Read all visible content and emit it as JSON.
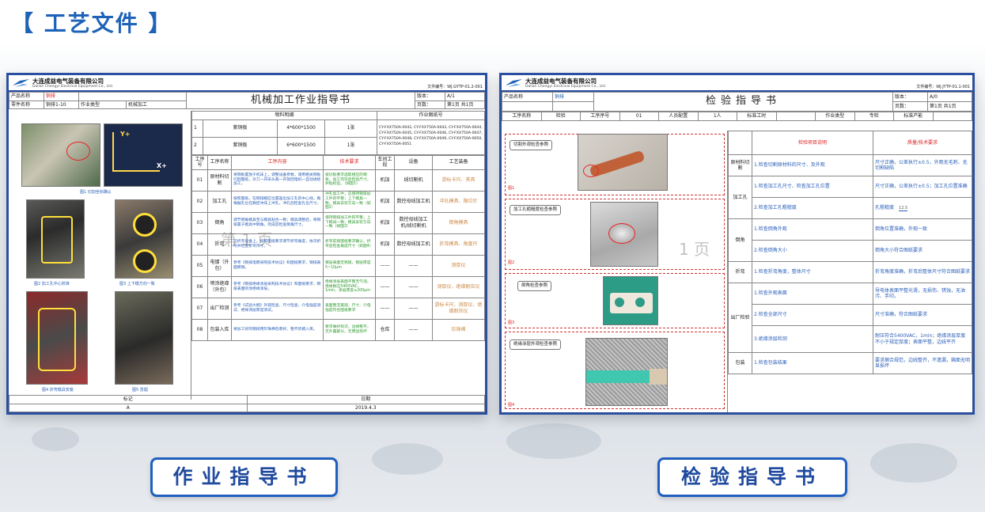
{
  "header": {
    "title": "【 工艺文件 】"
  },
  "buttons": {
    "work": "作业指导书",
    "inspect": "检验指导书"
  },
  "left_doc": {
    "company": "大连成益电气装备有限公司",
    "company_en": "Dalian Chengyi Electrical Equipment Co., Ltd.",
    "doc_code": "文件编号：WJ.GYTP-01.2-001",
    "product_label": "产品名称",
    "product_value": "铜排",
    "part_label": "零件名称",
    "part_value": "铜排1-10",
    "op_label": "作业类型",
    "op_value": "机械加工",
    "title": "机械加工作业指导书",
    "version_label": "版本：",
    "version_value": "A/1",
    "page_label": "页数：",
    "page_value": "第1页 共1页",
    "materials_header": "物料明细",
    "drawing_header": "作业图纸号",
    "materials": [
      {
        "no": "1",
        "name": "紫铜板",
        "spec": "4*600*1500",
        "qty": "1张",
        "drawing": "CY-FXX750A-0042, CY-FXX750A-0043, CY-FXX750A-0044, CY-FXX750A-0045, CY-FXX750A-0046, CY-FXX750A-0047, CY-FXX750A-0048, CY-FXX750A-0049, CY-FXX750A-0050, CY-FXX750A-0051"
      },
      {
        "no": "2",
        "name": "紫铜板",
        "spec": "6*600*1500",
        "qty": "1张",
        "drawing": ""
      }
    ],
    "step_headers": [
      "工序号",
      "工序名称",
      "工序内容",
      "技术要求",
      "车间工段",
      "设备",
      "工艺装备"
    ],
    "steps": [
      {
        "no": "01",
        "name": "原材料切割",
        "content": "将铜板置放于机床上，调整设备参数，调用相关铜板切割图纸，对刀一开床头裁一开放回电机一自动进给加工。",
        "req": "按切板要求选取相应的铜板，加工完毕后检验尺寸，并贴标签。（如图1）",
        "dept": "机加",
        "equip": "线切割机",
        "tool": "游标卡尺、夹具"
      },
      {
        "no": "02",
        "name": "加工孔",
        "content": "按照图纸，在铜排相应位置画出加工孔的中心线，再根据孔位在数控冲床上冲孔，冲孔后检查孔位尺寸。",
        "req": "冲孔加工中，应保持铜排加工件的平整；上下模具一致，模具安装方向一致（如图2）",
        "dept": "机加",
        "equip": "数控母线加工机",
        "tool": "冲孔模具、限位针"
      },
      {
        "no": "03",
        "name": "倒角",
        "content": "调节倒角模具至与模具贴合一致；模具调整后，将铜排置于模具中倒角，完成后检查倒角尺寸。",
        "req": "保持铜排加工件的平整，上下模具一致；模具安装方向一致（如图3）",
        "dept": "机加",
        "equip": "数控母线加工机/线切割机",
        "tool": "倒角模具"
      },
      {
        "no": "04",
        "name": "折弯",
        "content": "在折弯设备上，按照图纸要求调节折弯角度，依次折弯并检查折弯尺寸。",
        "req": "折弯前按图纸要求确认，折弯后检查角度尺寸（如图4）",
        "dept": "机加",
        "equip": "数控母线加工机",
        "tool": "折弯模具、角度尺"
      },
      {
        "no": "05",
        "name": "电镀（外包）",
        "content": "参考《铜排电镀采购技术协议》和图纸要求，铜排表面镀锡。",
        "req": "镀层表面无锈斑，镀层厚度5~10μm",
        "dept": "——",
        "equip": "——",
        "tool": "测厚仪"
      },
      {
        "no": "06",
        "name": "喷涂绝缘（外包）",
        "content": "参考《铜排绝缘涂层采购技术协议》和图纸要求，铜排表面喷涂绝缘涂层。",
        "req": "绝缘涂层表面平整无气泡，绝缘耐压5400VAC，1min，涂层厚度≥200μm",
        "dept": "——",
        "equip": "——",
        "tool": "测厚仪、绝缘耐压仪"
      },
      {
        "no": "07",
        "name": "出厂检测",
        "content": "参考《试验大纲》外观检查、尺寸检查、介电强度测试、绝缘涂层厚度测试。",
        "req": "表面整洁美观，尺寸、介电强度符合图纸要求",
        "dept": "——",
        "equip": "——",
        "tool": "游标卡尺、测厚仪、绝缘耐压仪"
      },
      {
        "no": "08",
        "name": "包装入库",
        "content": "将加工好的铜排用珍珠棉包裹好，整齐装箱入库。",
        "req": "要求做好标识，边缘整齐，无外露部分，无明显损坏",
        "dept": "仓库",
        "equip": "——",
        "tool": "珍珠棉"
      }
    ],
    "captions": [
      "图1 切割坐标确认",
      "图2 加工孔中心校准",
      "图3 上下模方向一致",
      "图4 折弯模具安装",
      "图5 冒烟"
    ],
    "footer_left": "标记",
    "footer_left_val": "A",
    "footer_right": "日期",
    "footer_right_val": "2019.4.3",
    "watermark": "第 1 页"
  },
  "right_doc": {
    "company": "大连成益电气装备有限公司",
    "company_en": "Dalian Chengyi Electrical Equipment Co., Ltd.",
    "doc_code": "文件编号：WJ.JYTP-01.1-001",
    "product_label": "产品名称",
    "product_value": "铜排",
    "title": "检验指导书",
    "version_label": "版本：",
    "version_value": "A/0",
    "page_label": "页数：",
    "page_value": "第1页 共1页",
    "proc_label": "工序名称",
    "proc_value": "检验",
    "procno_label": "工序序号",
    "procno_value": "01",
    "staff_label": "人员配置",
    "staff_value": "1人",
    "time_label": "标准工时",
    "time_value": "",
    "type_label": "作业类型",
    "type_value": "专检",
    "capacity_label": "标准产能",
    "capacity_value": "",
    "col_item": "检验项目说明",
    "col_req": "质量/技术要求",
    "photo_labels": [
      "切割外观检查参照",
      "加工孔粗糙度检查参照",
      "倒角检查参照",
      "绝缘涂层外观检查参照"
    ],
    "photo_tags": [
      "图1",
      "图2",
      "图3",
      "图4"
    ],
    "groups": [
      {
        "name": "原材料切割",
        "rows": [
          {
            "item": "1.检查切割原材料的尺寸、及外观",
            "req": "尺寸正确，公差执行±0.5，外观无毛刺、无切割缺陷"
          }
        ]
      },
      {
        "name": "加工孔",
        "rows": [
          {
            "item": "1.检查加工孔尺寸、检查加工孔位置",
            "req": "尺寸正确，公差执行±0.5；加工孔位置准确"
          },
          {
            "item": "2.检查加工孔粗糙度",
            "req": "孔粗糙度"
          }
        ]
      },
      {
        "name": "倒角",
        "rows": [
          {
            "item": "1.检查倒角外观",
            "req": "倒角位置准确，外观一致"
          },
          {
            "item": "2.检查倒角大小",
            "req": "倒角大小符合图纸要求"
          }
        ]
      },
      {
        "name": "折弯",
        "rows": [
          {
            "item": "1.检查折弯角度，整体尺寸",
            "req": "折弯角度准确，折弯后整体尺寸符合图纸要求"
          }
        ]
      },
      {
        "name": "出厂检验",
        "rows": [
          {
            "item": "1.检查外观表面",
            "req": "导电体表面平整光滑，无损伤、锈蚀，无油污、手印。"
          },
          {
            "item": "2.检查全部尺寸",
            "req": "尺寸准确，符合图纸要求"
          },
          {
            "item": "3.绝缘涂层检测",
            "req": "耐压符合5400VAC，1min；绝缘涂层厚度不小于规定厚度；表面平整，边线平齐"
          }
        ]
      },
      {
        "name": "包装",
        "rows": [
          {
            "item": "1.检查包装结果",
            "req": "要求捆合规范，边线整齐，不遗漏，箱面无明显损坏"
          }
        ]
      }
    ],
    "roughness_mark": "12.5",
    "watermark": "1 页"
  }
}
